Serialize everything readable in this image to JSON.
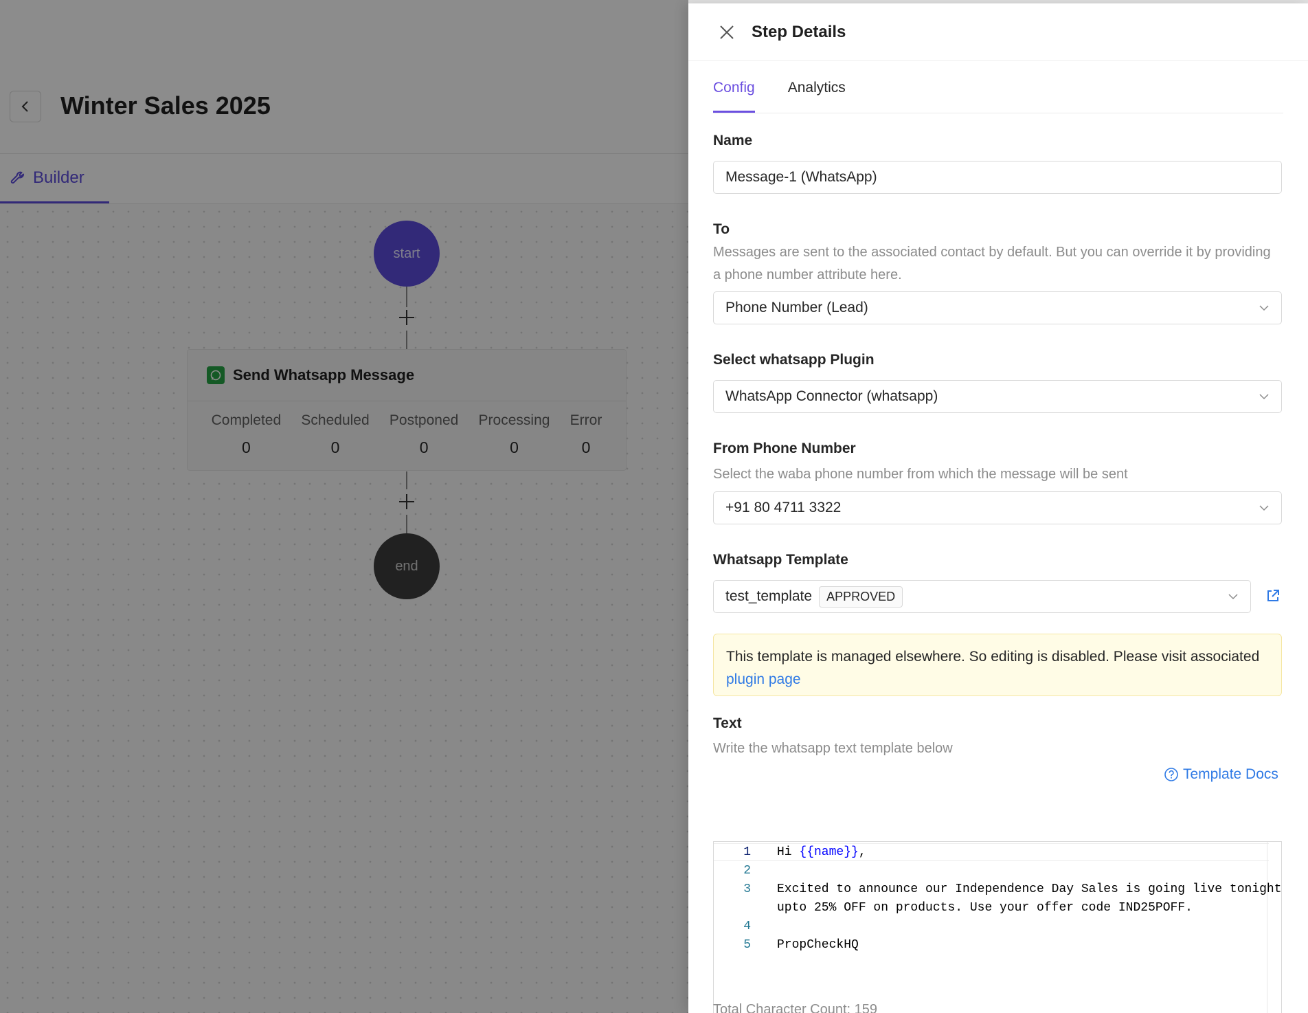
{
  "builder": {
    "title": "Winter Sales 2025",
    "tab_label": "Builder",
    "start_label": "start",
    "end_label": "end",
    "step": {
      "title": "Send Whatsapp Message",
      "stats": [
        {
          "label": "Completed",
          "value": "0"
        },
        {
          "label": "Scheduled",
          "value": "0"
        },
        {
          "label": "Postponed",
          "value": "0"
        },
        {
          "label": "Processing",
          "value": "0"
        },
        {
          "label": "Error",
          "value": "0"
        }
      ]
    }
  },
  "drawer": {
    "title": "Step Details",
    "tabs": [
      {
        "label": "Config",
        "active": true
      },
      {
        "label": "Analytics",
        "active": false
      }
    ],
    "name": {
      "label": "Name",
      "value": "Message-1 (WhatsApp)"
    },
    "to": {
      "label": "To",
      "help": "Messages are sent to the associated contact by default. But you can override it by providing a phone number attribute here.",
      "value": "Phone Number (Lead)"
    },
    "plugin": {
      "label": "Select whatsapp Plugin",
      "value": "WhatsApp Connector (whatsapp)"
    },
    "from_phone": {
      "label": "From Phone Number",
      "help": "Select the waba phone number from which the message will be sent",
      "value": "+91 80 4711 3322"
    },
    "template": {
      "label": "Whatsapp Template",
      "value": "test_template",
      "status": "APPROVED"
    },
    "notice": {
      "text": "This template is managed elsewhere. So editing is disabled. Please visit associated ",
      "link": "plugin page"
    },
    "text": {
      "label": "Text",
      "help": "Write the whatsapp text template below",
      "docs_link": "Template Docs",
      "lines": [
        {
          "num": "1",
          "prefix": "Hi ",
          "var": "{{name}}",
          "suffix": ","
        },
        {
          "num": "2",
          "text": ""
        },
        {
          "num": "3",
          "text": "Excited to announce our Independence Day Sales is going live tonight",
          "cont": "upto 25% OFF on products. Use your offer code IND25POFF."
        },
        {
          "num": "4",
          "text": ""
        },
        {
          "num": "5",
          "text": "PropCheckHQ"
        }
      ],
      "char_count": "Total Character Count: 159"
    }
  },
  "colors": {
    "accent": "#6b4fe0",
    "start_node": "#5b4bdb",
    "link": "#2f7ae5",
    "whatsapp": "#25a244"
  },
  "icons": [
    "chevron-left-icon",
    "wrench-icon",
    "whatsapp-icon",
    "plus-icon",
    "close-icon",
    "chevron-down-icon",
    "external-link-icon",
    "help-circle-icon"
  ]
}
